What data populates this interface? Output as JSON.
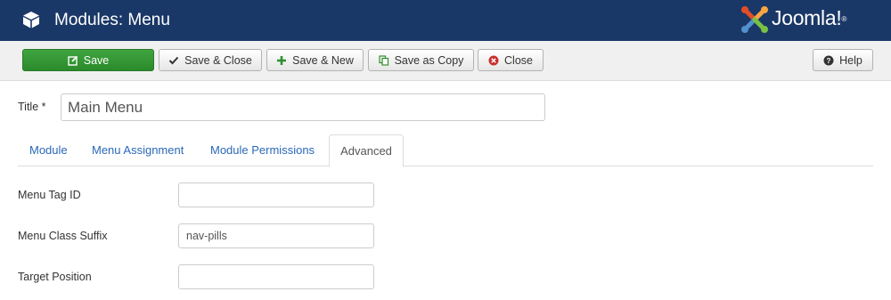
{
  "header": {
    "title": "Modules: Menu",
    "icon": "cube-icon",
    "brand": "Joomla!",
    "brand_mark": "®",
    "colors": {
      "bar": "#1a3867",
      "logo_red": "#e44d26",
      "logo_orange": "#f9a541",
      "logo_blue": "#5091cd",
      "logo_green": "#7ac143"
    }
  },
  "toolbar": {
    "save": "Save",
    "save_close": "Save & Close",
    "save_new": "Save & New",
    "save_copy": "Save as Copy",
    "close": "Close",
    "help": "Help",
    "colors": {
      "save": "#2f8f2f"
    }
  },
  "form": {
    "title_label": "Title *",
    "title_value": "Main Menu"
  },
  "tabs": [
    {
      "label": "Module"
    },
    {
      "label": "Menu Assignment"
    },
    {
      "label": "Module Permissions"
    },
    {
      "label": "Advanced",
      "active": true
    }
  ],
  "advanced": {
    "menu_tag_id": {
      "label": "Menu Tag ID",
      "value": ""
    },
    "menu_class_suffix": {
      "label": "Menu Class Suffix",
      "value": "nav-pills"
    },
    "target_position": {
      "label": "Target Position",
      "value": ""
    }
  }
}
